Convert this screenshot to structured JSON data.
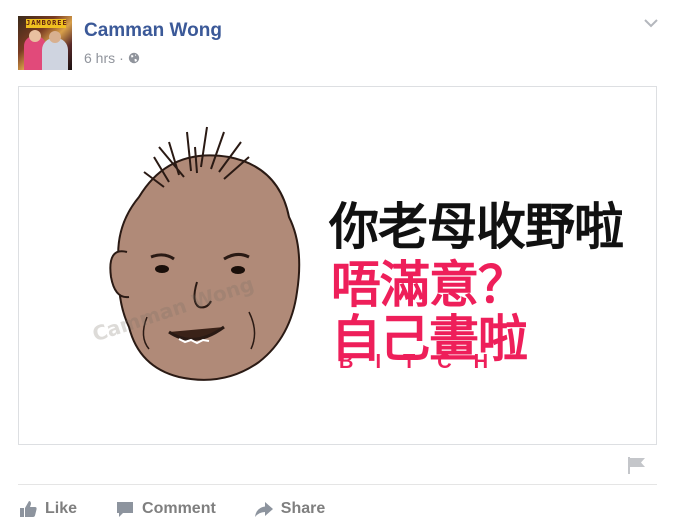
{
  "post": {
    "author_name": "Camman Wong",
    "timestamp": "6 hrs",
    "separator": "·",
    "privacy_icon": "globe-icon",
    "options_icon": "chevron-down-icon"
  },
  "avatar": {
    "banner_text": "JAMBOREE"
  },
  "image": {
    "line1": "你老母收野啦",
    "line2": "唔滿意？",
    "line3": "自己畫啦",
    "line4": "BITCH",
    "watermark": "Camman Wong",
    "colors": {
      "black_text": "#111111",
      "pink_text": "#ee1f5a",
      "skin": "#b08a78"
    }
  },
  "actions": {
    "like_label": "Like",
    "comment_label": "Comment",
    "share_label": "Share"
  },
  "colors": {
    "author_blue": "#3b5998",
    "meta_grey": "#90949c",
    "action_grey": "#7f7f7f"
  }
}
